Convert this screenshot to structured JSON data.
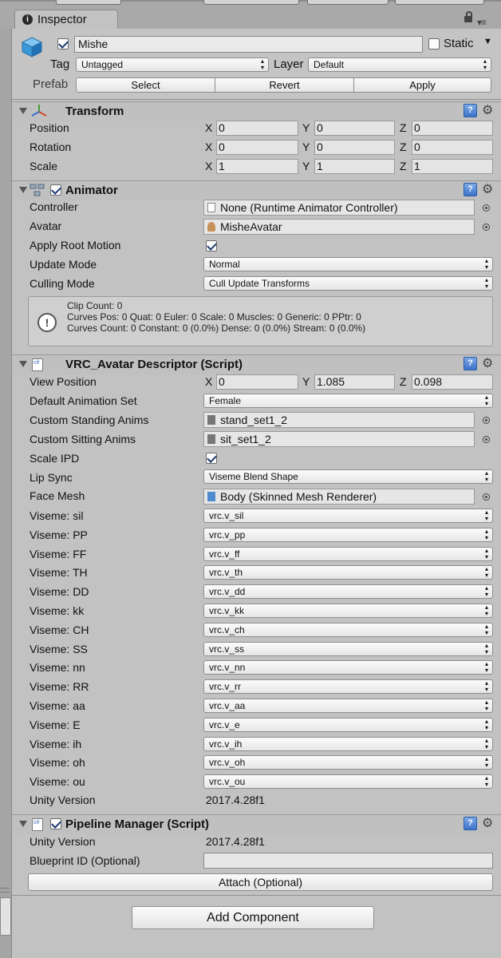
{
  "inspector": {
    "tab_label": "Inspector"
  },
  "object": {
    "name": "Mishe",
    "active": true,
    "static_label": "Static",
    "static": false,
    "tag_label": "Tag",
    "tag_value": "Untagged",
    "layer_label": "Layer",
    "layer_value": "Default",
    "prefab_label": "Prefab",
    "prefab_select": "Select",
    "prefab_revert": "Revert",
    "prefab_apply": "Apply"
  },
  "transform": {
    "title": "Transform",
    "rows": [
      {
        "label": "Position",
        "x": "0",
        "y": "0",
        "z": "0"
      },
      {
        "label": "Rotation",
        "x": "0",
        "y": "0",
        "z": "0"
      },
      {
        "label": "Scale",
        "x": "1",
        "y": "1",
        "z": "1"
      }
    ],
    "axis_x": "X",
    "axis_y": "Y",
    "axis_z": "Z"
  },
  "animator": {
    "title": "Animator",
    "enabled": true,
    "controller_label": "Controller",
    "controller_value": "None (Runtime Animator Controller)",
    "avatar_label": "Avatar",
    "avatar_value": "MisheAvatar",
    "apply_root_motion_label": "Apply Root Motion",
    "apply_root_motion": true,
    "update_mode_label": "Update Mode",
    "update_mode_value": "Normal",
    "culling_mode_label": "Culling Mode",
    "culling_mode_value": "Cull Update Transforms",
    "info_lines": [
      "Clip Count: 0",
      "Curves Pos: 0 Quat: 0 Euler: 0 Scale: 0 Muscles: 0 Generic: 0 PPtr: 0",
      "Curves Count: 0 Constant: 0 (0.0%) Dense: 0 (0.0%) Stream: 0 (0.0%)"
    ]
  },
  "descriptor": {
    "title": "VRC_Avatar Descriptor (Script)",
    "view_position_label": "View Position",
    "view_position": {
      "x": "0",
      "y": "1.085",
      "z": "0.098"
    },
    "default_anim_set_label": "Default Animation Set",
    "default_anim_set_value": "Female",
    "standing_label": "Custom Standing Anims",
    "standing_value": "stand_set1_2",
    "sitting_label": "Custom Sitting Anims",
    "sitting_value": "sit_set1_2",
    "scale_ipd_label": "Scale IPD",
    "scale_ipd": true,
    "lip_sync_label": "Lip Sync",
    "lip_sync_value": "Viseme Blend Shape",
    "face_mesh_label": "Face Mesh",
    "face_mesh_value": "Body (Skinned Mesh Renderer)",
    "visemes": [
      {
        "label": "Viseme: sil",
        "value": "vrc.v_sil"
      },
      {
        "label": "Viseme: PP",
        "value": "vrc.v_pp"
      },
      {
        "label": "Viseme: FF",
        "value": "vrc.v_ff"
      },
      {
        "label": "Viseme: TH",
        "value": "vrc.v_th"
      },
      {
        "label": "Viseme: DD",
        "value": "vrc.v_dd"
      },
      {
        "label": "Viseme: kk",
        "value": "vrc.v_kk"
      },
      {
        "label": "Viseme: CH",
        "value": "vrc.v_ch"
      },
      {
        "label": "Viseme: SS",
        "value": "vrc.v_ss"
      },
      {
        "label": "Viseme: nn",
        "value": "vrc.v_nn"
      },
      {
        "label": "Viseme: RR",
        "value": "vrc.v_rr"
      },
      {
        "label": "Viseme: aa",
        "value": "vrc.v_aa"
      },
      {
        "label": "Viseme: E",
        "value": "vrc.v_e"
      },
      {
        "label": "Viseme: ih",
        "value": "vrc.v_ih"
      },
      {
        "label": "Viseme: oh",
        "value": "vrc.v_oh"
      },
      {
        "label": "Viseme: ou",
        "value": "vrc.v_ou"
      }
    ],
    "unity_version_label": "Unity Version",
    "unity_version_value": "2017.4.28f1"
  },
  "pipeline": {
    "title": "Pipeline Manager (Script)",
    "enabled": true,
    "unity_version_label": "Unity Version",
    "unity_version_value": "2017.4.28f1",
    "blueprint_label": "Blueprint ID (Optional)",
    "blueprint_value": "",
    "attach_label": "Attach (Optional)"
  },
  "add_component_label": "Add Component",
  "colors": {
    "panel": "#c2c2c2",
    "help_blue": "#3c73c9",
    "check": "#1d3c72"
  }
}
